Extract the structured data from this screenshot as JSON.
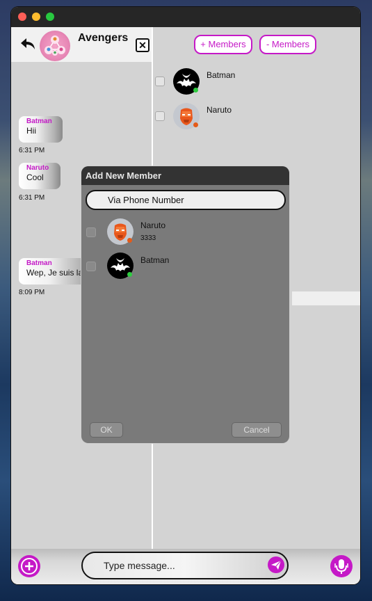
{
  "chat": {
    "title": "Avengers",
    "messages": [
      {
        "sender": "Batman",
        "text": "Hii",
        "time": "6:31 PM"
      },
      {
        "sender": "Naruto",
        "text": "Cool",
        "time": "6:31 PM"
      },
      {
        "sender": "Batman",
        "text": "Wep, Je suis la",
        "time": "8:09 PM"
      }
    ],
    "composer": {
      "placeholder": "Type message..."
    }
  },
  "members_panel": {
    "add_label": "+ Members",
    "remove_label": "- Members",
    "members": [
      {
        "name": "Batman",
        "status_color": "#2ecc40",
        "avatar": "bat-avatar"
      },
      {
        "name": "Naruto",
        "status_color": "#e45b1a",
        "avatar": "ironman-avatar"
      }
    ]
  },
  "dialog": {
    "title": "Add New Member",
    "phone_placeholder": "Via Phone Number",
    "contacts": [
      {
        "name": "Naruto",
        "phone": "3333",
        "status_color": "#e45b1a",
        "avatar": "ironman-avatar"
      },
      {
        "name": "Batman",
        "phone": "",
        "status_color": "#2ecc40",
        "avatar": "bat-avatar"
      }
    ],
    "ok_label": "OK",
    "cancel_label": "Cancel"
  },
  "colors": {
    "accent": "#c519c7",
    "titlebar": "#262626",
    "pane": "#d3d3d3"
  }
}
